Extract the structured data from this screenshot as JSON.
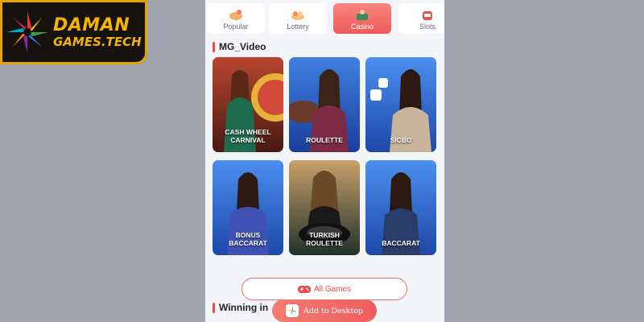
{
  "logo": {
    "line1": "DAMAN",
    "line2": "GAMES.TECH",
    "icon": "star-burst-logo-icon"
  },
  "tabs": [
    {
      "label": "Popular",
      "icon": "popular-icon",
      "active": false
    },
    {
      "label": "Lottery",
      "icon": "lottery-icon",
      "active": false
    },
    {
      "label": "Casino",
      "icon": "casino-icon",
      "active": true
    },
    {
      "label": "Slots",
      "icon": "slots-icon",
      "active": false
    }
  ],
  "section": {
    "title": "MG_Video"
  },
  "games": [
    {
      "label": "CASH WHEEL\nCARNIVAL"
    },
    {
      "label": "ROULETTE"
    },
    {
      "label": "SICBO"
    },
    {
      "label": "BONUS\nBACCARAT"
    },
    {
      "label": "TURKISH\nROULETTE"
    },
    {
      "label": "BACCARAT"
    }
  ],
  "all_games": {
    "label": "All Games",
    "icon": "gamepad-icon"
  },
  "winning": {
    "title": "Winning in"
  },
  "add_desktop": {
    "label": "Add to Desktop",
    "icon": "app-icon"
  },
  "colors": {
    "accent": "#ef4b4b",
    "logo_gold": "#f4b400",
    "background": "#a1a3ae"
  }
}
